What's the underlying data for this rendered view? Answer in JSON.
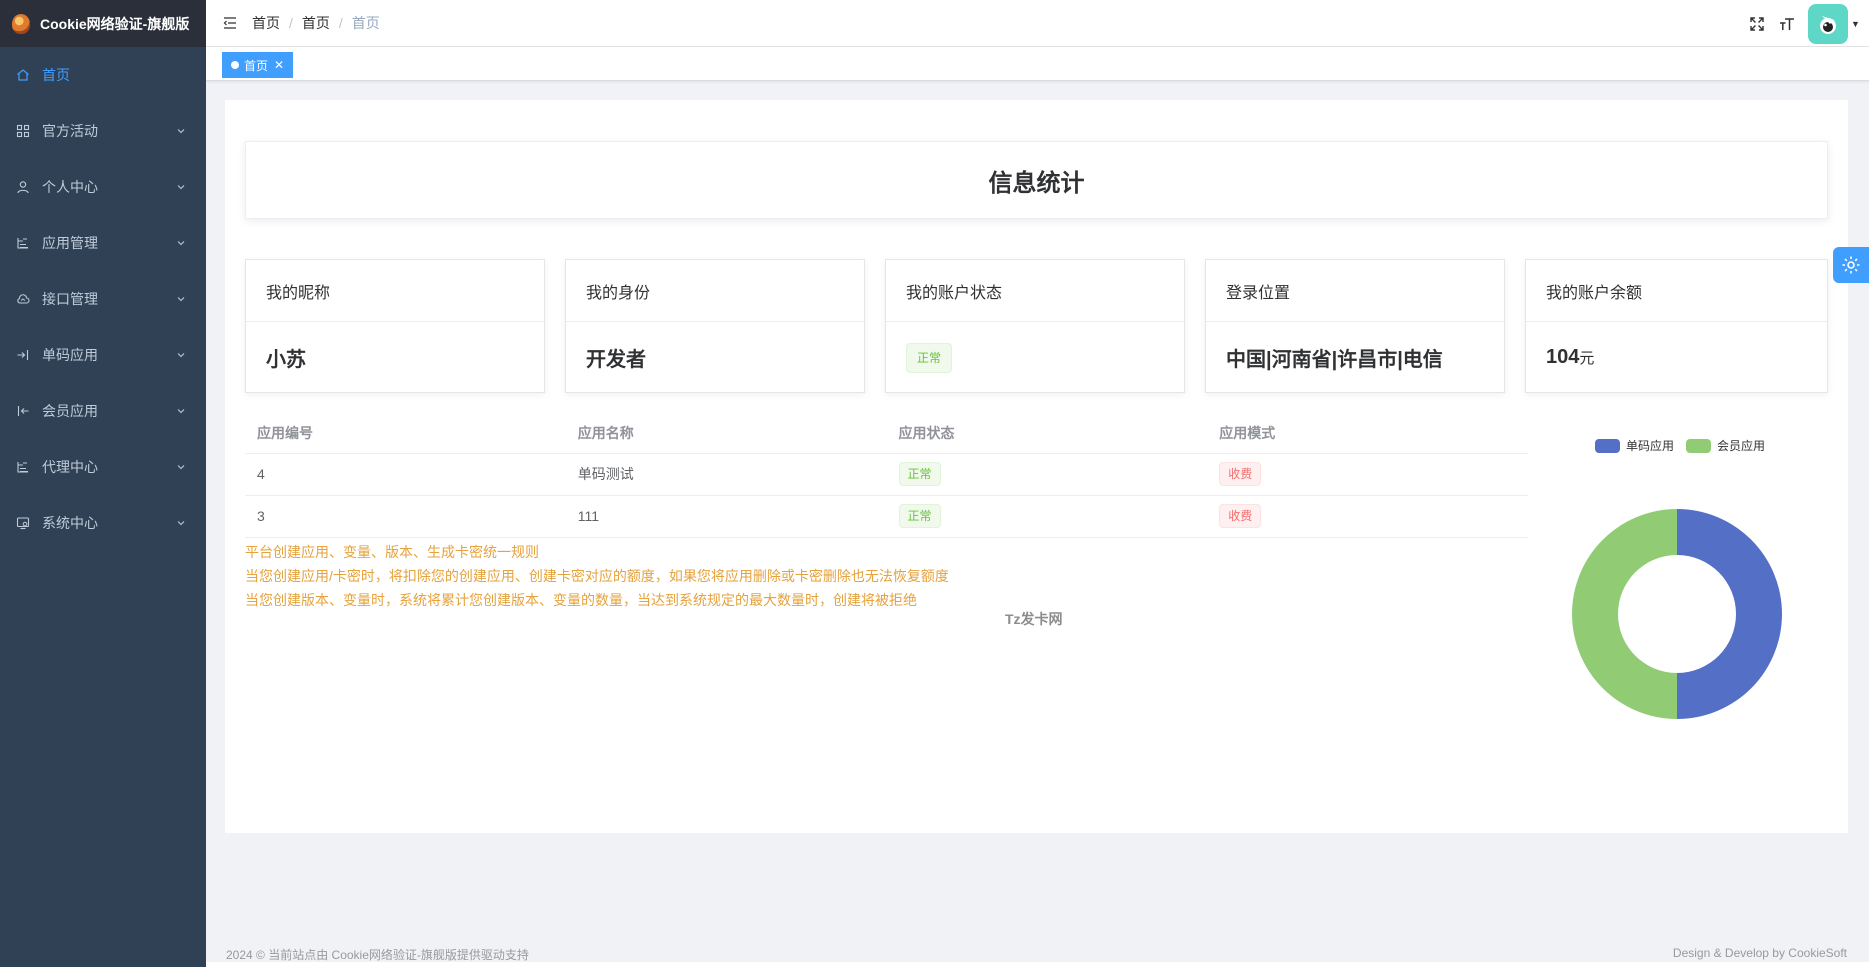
{
  "brand": {
    "title": "Cookie网络验证-旗舰版"
  },
  "sidebar": {
    "items": [
      {
        "label": "首页",
        "icon": "home-icon",
        "active": true,
        "expandable": false
      },
      {
        "label": "官方活动",
        "icon": "grid-icon",
        "expandable": true
      },
      {
        "label": "个人中心",
        "icon": "user-icon",
        "expandable": true
      },
      {
        "label": "应用管理",
        "icon": "tree-icon",
        "expandable": true
      },
      {
        "label": "接口管理",
        "icon": "cloud-icon",
        "expandable": true
      },
      {
        "label": "单码应用",
        "icon": "login-icon",
        "expandable": true
      },
      {
        "label": "会员应用",
        "icon": "logout-icon",
        "expandable": true
      },
      {
        "label": "代理中心",
        "icon": "tree-icon",
        "expandable": true
      },
      {
        "label": "系统中心",
        "icon": "monitor-icon",
        "expandable": true
      }
    ]
  },
  "breadcrumb": [
    "首页",
    "首页",
    "首页"
  ],
  "tags": [
    {
      "label": "首页",
      "active": true
    }
  ],
  "stats": {
    "title": "信息统计",
    "cards": [
      {
        "label": "我的昵称",
        "value": "小苏"
      },
      {
        "label": "我的身份",
        "value": "开发者"
      },
      {
        "label": "我的账户状态",
        "value": "正常"
      },
      {
        "label": "登录位置",
        "value": "中国|河南省|许昌市|电信"
      },
      {
        "label": "我的账户余额",
        "value": "104",
        "unit": "元"
      }
    ]
  },
  "table": {
    "headers": [
      "应用编号",
      "应用名称",
      "应用状态",
      "应用模式"
    ],
    "rows": [
      [
        "4",
        "单码测试",
        "正常",
        "收费"
      ],
      [
        "3",
        "111",
        "正常",
        "收费"
      ]
    ]
  },
  "notices": [
    "平台创建应用、变量、版本、生成卡密统一规则",
    "当您创建应用/卡密时，将扣除您的创建应用、创建卡密对应的额度，如果您将应用删除或卡密删除也无法恢复额度",
    "当您创建版本、变量时，系统将累计您创建版本、变量的数量，当达到系统规定的最大数量时，创建将被拒绝"
  ],
  "watermark": "Tz发卡网",
  "chart_data": {
    "type": "pie",
    "series": [
      {
        "name": "单码应用",
        "value": 1,
        "color": "#5470c6"
      },
      {
        "name": "会员应用",
        "value": 1,
        "color": "#91cc75"
      }
    ],
    "legend_position": "top"
  },
  "footer": {
    "left": "2024 © 当前站点由 Cookie网络验证-旗舰版提供驱动支持",
    "right": "Design & Develop by CookieSoft"
  },
  "colors": {
    "sidebar": "#304156",
    "accent": "#409eff",
    "warning": "#e6a23c"
  }
}
